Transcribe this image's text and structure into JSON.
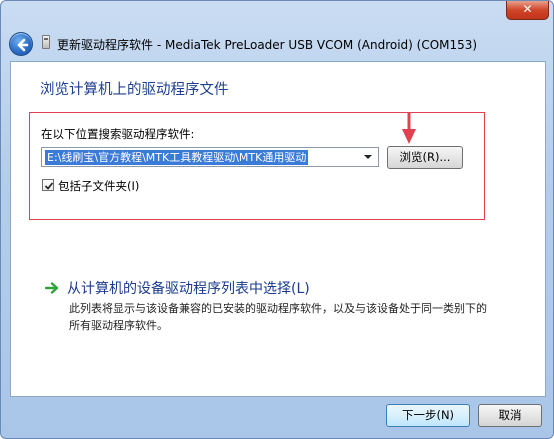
{
  "window": {
    "title": "更新驱动程序软件 - MediaTek PreLoader USB VCOM (Android) (COM153)",
    "close_label": "✕"
  },
  "page": {
    "heading": "浏览计算机上的驱动程序文件"
  },
  "search": {
    "label": "在以下位置搜索驱动程序软件:",
    "path_value": "E:\\线刷宝\\官方教程\\MTK工具教程驱动\\MTK通用驱动",
    "browse_label": "浏览(R)...",
    "include_subfolders_label": "包括子文件夹(I)",
    "include_subfolders_checked": true
  },
  "pick_from_list": {
    "link": "从计算机的设备驱动程序列表中选择(L)",
    "description": "此列表将显示与该设备兼容的已安装的驱动程序软件，以及与该设备处于同一类别下的所有驱动程序软件。"
  },
  "footer": {
    "next_label": "下一步(N)",
    "cancel_label": "取消"
  },
  "colors": {
    "accent_heading": "#1f3f8f",
    "highlight_border": "#e0424f",
    "selection": "#3a7bd9",
    "green_arrow": "#2fa43a"
  },
  "icons": [
    "back-arrow-icon",
    "device-icon",
    "close-icon",
    "dropdown-arrow-icon",
    "red-arrow-icon",
    "checkmark-icon",
    "green-arrow-icon"
  ]
}
